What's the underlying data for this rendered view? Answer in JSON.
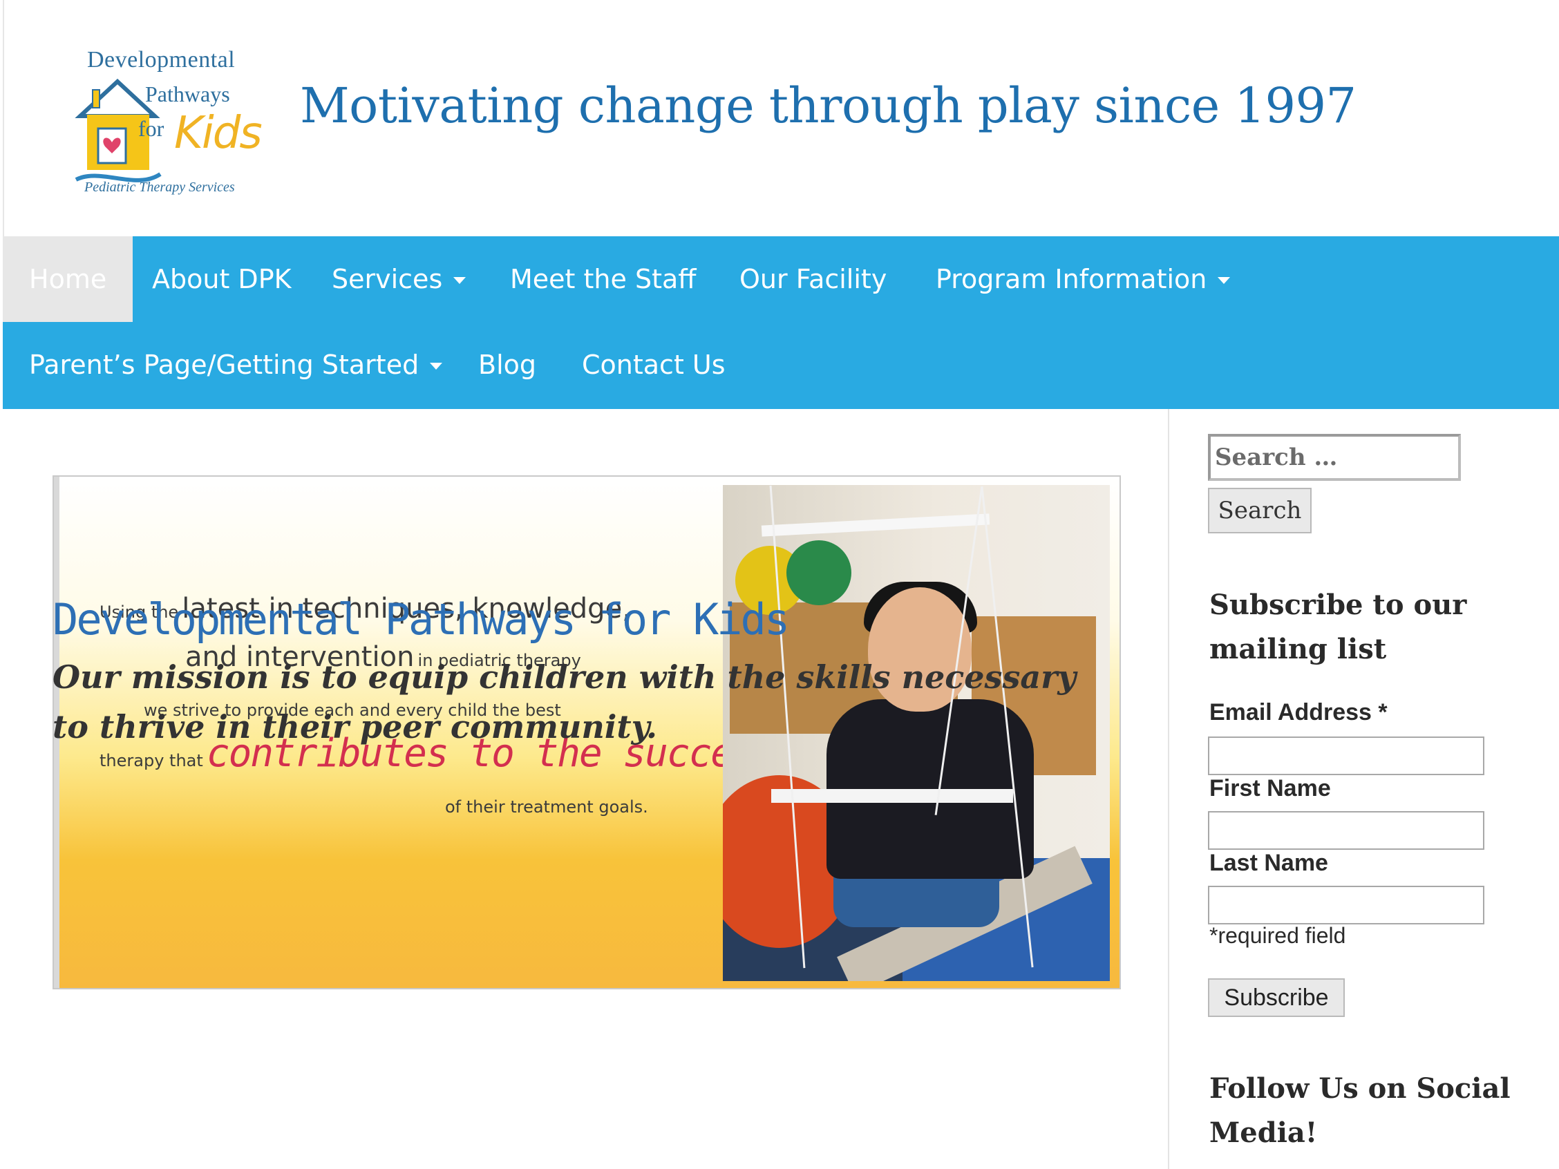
{
  "header": {
    "logo": {
      "line1": "Developmental",
      "line2": "Pathways",
      "line3": "for",
      "line4": "Kids",
      "line5": "Pediatric Therapy Services"
    },
    "tagline": "Motivating change through play since 1997"
  },
  "nav": {
    "items": [
      {
        "label": "Home",
        "active": true
      },
      {
        "label": "About DPK"
      },
      {
        "label": "Services",
        "dropdown": true
      },
      {
        "label": "Meet the Staff"
      },
      {
        "label": "Our Facility"
      },
      {
        "label": "Program Information",
        "dropdown": true
      },
      {
        "label": "Parent’s Page/Getting Started",
        "dropdown": true
      },
      {
        "label": "Blog"
      },
      {
        "label": "Contact Us"
      }
    ],
    "colors": {
      "bar": "#29aae2",
      "active_bg": "#e7e7e7"
    }
  },
  "banner": {
    "t1a": "Using the",
    "t1b": "latest in techniques, knowledge,",
    "t2a": "and intervention",
    "t2b": "in pediatric therapy",
    "t3": "we strive to provide each and every child the best",
    "t4a": "therapy that",
    "t4b": "contributes to the success",
    "t5": "of their treatment goals."
  },
  "main": {
    "site_title": "Developmental Pathways for Kids",
    "mission": "Our mission is to equip children with the skills necessary to thrive in their peer community."
  },
  "sidebar": {
    "search": {
      "placeholder": "Search …",
      "button": "Search"
    },
    "subscribe": {
      "title": "Subscribe to our mailing list",
      "email_label": "Email Address *",
      "first_name_label": "First Name",
      "last_name_label": "Last Name",
      "required_note": "*required field",
      "button": "Subscribe"
    },
    "social_title": "Follow Us on Social Media!"
  }
}
